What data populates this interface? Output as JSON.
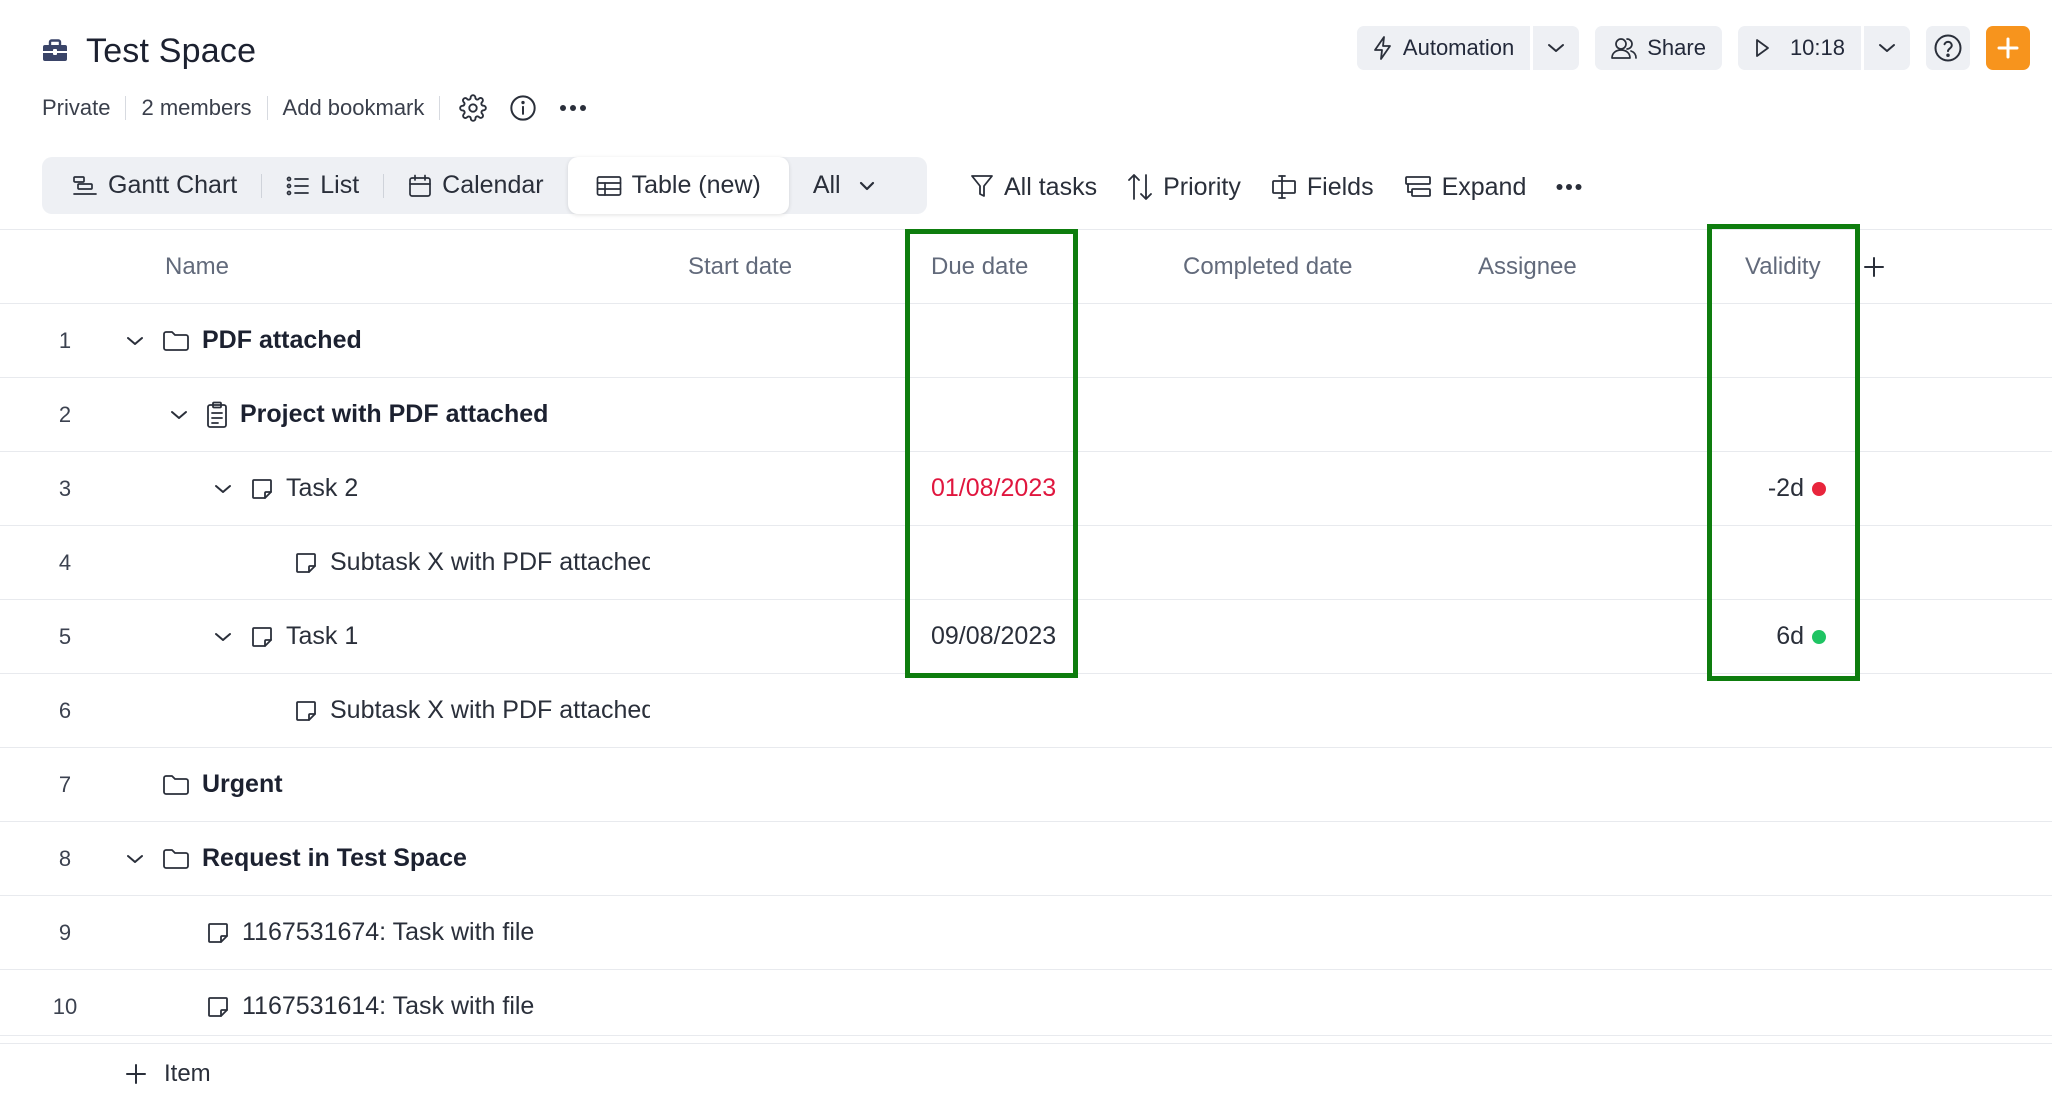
{
  "space": {
    "title": "Test Space",
    "icon": "briefcase-icon"
  },
  "meta": {
    "visibility": "Private",
    "members": "2 members",
    "bookmark": "Add bookmark"
  },
  "header": {
    "automation_label": "Automation",
    "share_label": "Share",
    "timer": "10:18"
  },
  "views": {
    "tabs": [
      {
        "label": "Gantt Chart",
        "icon": "gantt-icon"
      },
      {
        "label": "List",
        "icon": "list-icon"
      },
      {
        "label": "Calendar",
        "icon": "calendar-icon"
      },
      {
        "label": "Table (new)",
        "icon": "table-icon",
        "active": true
      }
    ],
    "filter_label": "All"
  },
  "tools": {
    "all_tasks": "All tasks",
    "priority": "Priority",
    "fields": "Fields",
    "expand": "Expand"
  },
  "columns": {
    "name": "Name",
    "start": "Start date",
    "due": "Due date",
    "completed": "Completed date",
    "assignee": "Assignee",
    "validity": "Validity"
  },
  "rows": [
    {
      "num": "1",
      "name": "PDF attached",
      "type": "folder",
      "bold": true,
      "expanded": true,
      "due": "",
      "validity": ""
    },
    {
      "num": "2",
      "name": "Project with PDF attached",
      "type": "project",
      "bold": true,
      "expanded": true,
      "due": "",
      "validity": ""
    },
    {
      "num": "3",
      "name": "Task 2",
      "type": "task",
      "bold": false,
      "expanded": true,
      "due": "01/08/2023",
      "due_overdue": true,
      "validity": "-2d",
      "validity_status": "red"
    },
    {
      "num": "4",
      "name": "Subtask X with PDF attached",
      "type": "task",
      "bold": false,
      "due": "",
      "validity": ""
    },
    {
      "num": "5",
      "name": "Task 1",
      "type": "task",
      "bold": false,
      "expanded": true,
      "due": "09/08/2023",
      "due_overdue": false,
      "validity": "6d",
      "validity_status": "green"
    },
    {
      "num": "6",
      "name": "Subtask X with PDF attached",
      "type": "task",
      "bold": false,
      "due": "",
      "validity": ""
    },
    {
      "num": "7",
      "name": "Urgent",
      "type": "folder",
      "bold": true,
      "due": "",
      "validity": ""
    },
    {
      "num": "8",
      "name": "Request in Test Space",
      "type": "folder",
      "bold": true,
      "expanded": true,
      "due": "",
      "validity": ""
    },
    {
      "num": "9",
      "name": "1167531674: Task with file",
      "type": "task",
      "bold": false,
      "due": "",
      "validity": ""
    },
    {
      "num": "10",
      "name": "1167531614: Task with file",
      "type": "task",
      "bold": false,
      "due": "",
      "validity": ""
    }
  ],
  "footer": {
    "add_item": "Item"
  },
  "colors": {
    "accent": "#f7941d",
    "highlight": "#0e7d0e",
    "overdue": "#e0163e",
    "status_red": "#e8253c",
    "status_green": "#1fc463"
  }
}
